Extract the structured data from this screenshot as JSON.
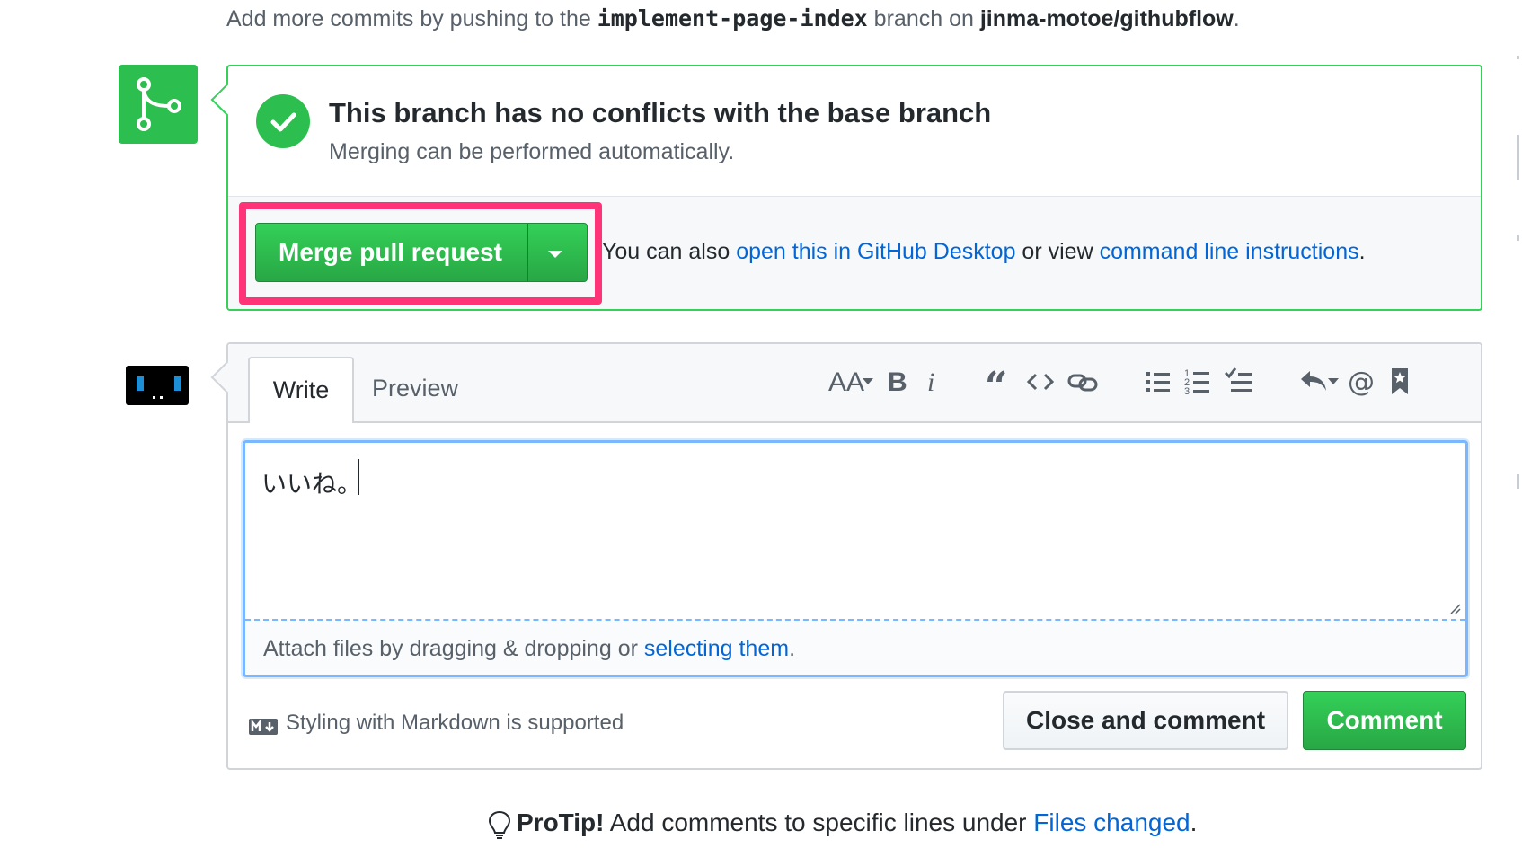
{
  "top_line": {
    "prefix": "Add more commits by pushing to the ",
    "branch": "implement-page-index",
    "middle": " branch on ",
    "repo": "jinma-motoe/githubflow",
    "suffix": "."
  },
  "merge": {
    "icon": "git-merge-icon",
    "status_icon": "check-icon",
    "heading": "This branch has no conflicts with the base branch",
    "subtext": "Merging can be performed automatically.",
    "button_label": "Merge pull request",
    "dropdown_icon": "caret-down-icon",
    "also_prefix": "You can also ",
    "desktop_link": "open this in GitHub Desktop",
    "also_middle": " or view ",
    "cli_link": "command line instructions",
    "also_suffix": ".",
    "highlight_color": "#ff3377"
  },
  "comment": {
    "tabs": [
      {
        "label": "Write",
        "selected": true
      },
      {
        "label": "Preview",
        "selected": false
      }
    ],
    "toolbar": [
      "text-size-icon",
      "bold-icon",
      "italic-icon",
      "quote-icon",
      "code-icon",
      "link-icon",
      "unordered-list-icon",
      "ordered-list-icon",
      "task-list-icon",
      "reply-icon",
      "mention-icon",
      "bookmark-icon"
    ],
    "textarea_value": "いいね。",
    "attach_prefix": "Attach files by dragging & dropping or ",
    "attach_link": "selecting them",
    "attach_suffix": ".",
    "markdown_note": "Styling with Markdown is supported",
    "close_button": "Close and comment",
    "comment_button": "Comment"
  },
  "protip": {
    "label": "ProTip!",
    "text": " Add comments to specific lines under ",
    "link": "Files changed",
    "suffix": "."
  },
  "colors": {
    "accent_green": "#2cbe4e",
    "link_blue": "#0366d6",
    "focus_blue": "#79b8ff"
  }
}
